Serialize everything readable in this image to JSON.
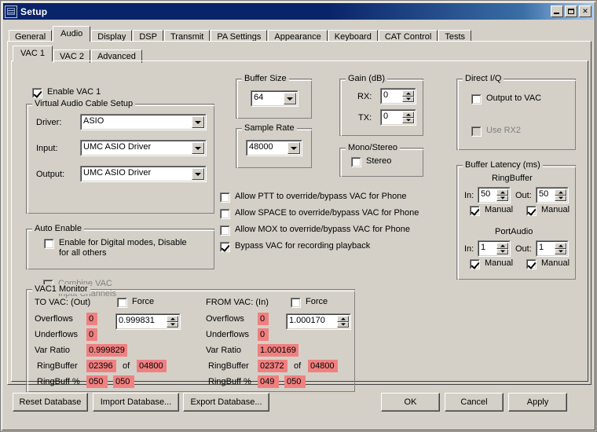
{
  "window": {
    "title": "Setup",
    "icon": "app-icon",
    "buttons": {
      "minimize": "minimize",
      "maximize": "maximize",
      "close": "✕"
    }
  },
  "tabs": {
    "items": [
      {
        "label": "General",
        "active": false
      },
      {
        "label": "Audio",
        "active": true
      },
      {
        "label": "Display",
        "active": false
      },
      {
        "label": "DSP",
        "active": false
      },
      {
        "label": "Transmit",
        "active": false
      },
      {
        "label": "PA Settings",
        "active": false
      },
      {
        "label": "Appearance",
        "active": false
      },
      {
        "label": "Keyboard",
        "active": false
      },
      {
        "label": "CAT Control",
        "active": false
      },
      {
        "label": "Tests",
        "active": false
      }
    ]
  },
  "subtabs": {
    "items": [
      {
        "label": "VAC 1",
        "active": true
      },
      {
        "label": "VAC 2",
        "active": false
      },
      {
        "label": "Advanced",
        "active": false
      }
    ]
  },
  "enable_vac": {
    "label": "Enable VAC 1",
    "checked": true
  },
  "vac_setup": {
    "legend": "Virtual Audio Cable Setup",
    "driver_label": "Driver:",
    "driver_value": "ASIO",
    "input_label": "Input:",
    "input_value": "UMC ASIO Driver",
    "output_label": "Output:",
    "output_value": "UMC ASIO Driver"
  },
  "auto_enable": {
    "legend": "Auto Enable",
    "checkbox_label": "Enable for Digital modes, Disable\nfor all others",
    "checked": false
  },
  "combine_vac": {
    "label": "Combine VAC\nInput Channels",
    "checked": false,
    "disabled": true
  },
  "buffer_size": {
    "legend": "Buffer Size",
    "value": "64"
  },
  "sample_rate": {
    "legend": "Sample Rate",
    "value": "48000"
  },
  "gain": {
    "legend": "Gain (dB)",
    "rx_label": "RX:",
    "rx_value": "0",
    "tx_label": "TX:",
    "tx_value": "0"
  },
  "mono_stereo": {
    "legend": "Mono/Stereo",
    "stereo_label": "Stereo",
    "stereo_checked": false
  },
  "direct_iq": {
    "legend": "Direct I/Q",
    "output_label": "Output to VAC",
    "output_checked": false,
    "rx2_label": "Use RX2",
    "rx2_checked": false,
    "rx2_disabled": true
  },
  "buffer_latency": {
    "legend": "Buffer Latency (ms)",
    "ringbuffer_title": "RingBuffer",
    "rb_in_label": "In:",
    "rb_in_value": "50",
    "rb_out_label": "Out:",
    "rb_out_value": "50",
    "rb_in_manual_label": "Manual",
    "rb_in_manual_checked": true,
    "rb_out_manual_label": "Manual",
    "rb_out_manual_checked": true,
    "portaudio_title": "PortAudio",
    "pa_in_label": "In:",
    "pa_in_value": "1",
    "pa_out_label": "Out:",
    "pa_out_value": "1",
    "pa_in_manual_label": "Manual",
    "pa_in_manual_checked": true,
    "pa_out_manual_label": "Manual",
    "pa_out_manual_checked": true
  },
  "override_options": [
    {
      "label": "Allow PTT to override/bypass VAC for Phone",
      "checked": false
    },
    {
      "label": "Allow SPACE to override/bypass VAC for Phone",
      "checked": false
    },
    {
      "label": "Allow MOX to override/bypass VAC for Phone",
      "checked": false
    },
    {
      "label": "Bypass VAC for recording playback",
      "checked": true
    }
  ],
  "monitor": {
    "legend": "VAC1 Monitor",
    "row_labels": {
      "overflows": "Overflows",
      "underflows": "Underflows",
      "var_ratio": "Var Ratio",
      "ringbuffer": "RingBuffer",
      "ringbuff_pct": "RingBuff %",
      "of": "of"
    },
    "out": {
      "title": "TO VAC: (Out)",
      "force_label": "Force",
      "force_checked": false,
      "force_value": "0.999831",
      "overflows": "0",
      "underflows": "0",
      "var_ratio": "0.999829",
      "ringbuffer_cur": "02396",
      "ringbuffer_max": "04800",
      "ringbuff_pct_a": "050",
      "ringbuff_pct_b": "050"
    },
    "in": {
      "title": "FROM VAC: (In)",
      "force_label": "Force",
      "force_checked": false,
      "force_value": "1.000170",
      "overflows": "0",
      "underflows": "0",
      "var_ratio": "1.000169",
      "ringbuffer_cur": "02372",
      "ringbuffer_max": "04800",
      "ringbuff_pct_a": "049",
      "ringbuff_pct_b": "050"
    }
  },
  "footer": {
    "reset_database": "Reset Database",
    "import_database": "Import Database...",
    "export_database": "Export Database...",
    "ok": "OK",
    "cancel": "Cancel",
    "apply": "Apply"
  },
  "colors": {
    "face": "#d4d0c8",
    "title_bar": "#0a246a",
    "monitor_field": "#f08080",
    "disabled_text": "#808080"
  }
}
